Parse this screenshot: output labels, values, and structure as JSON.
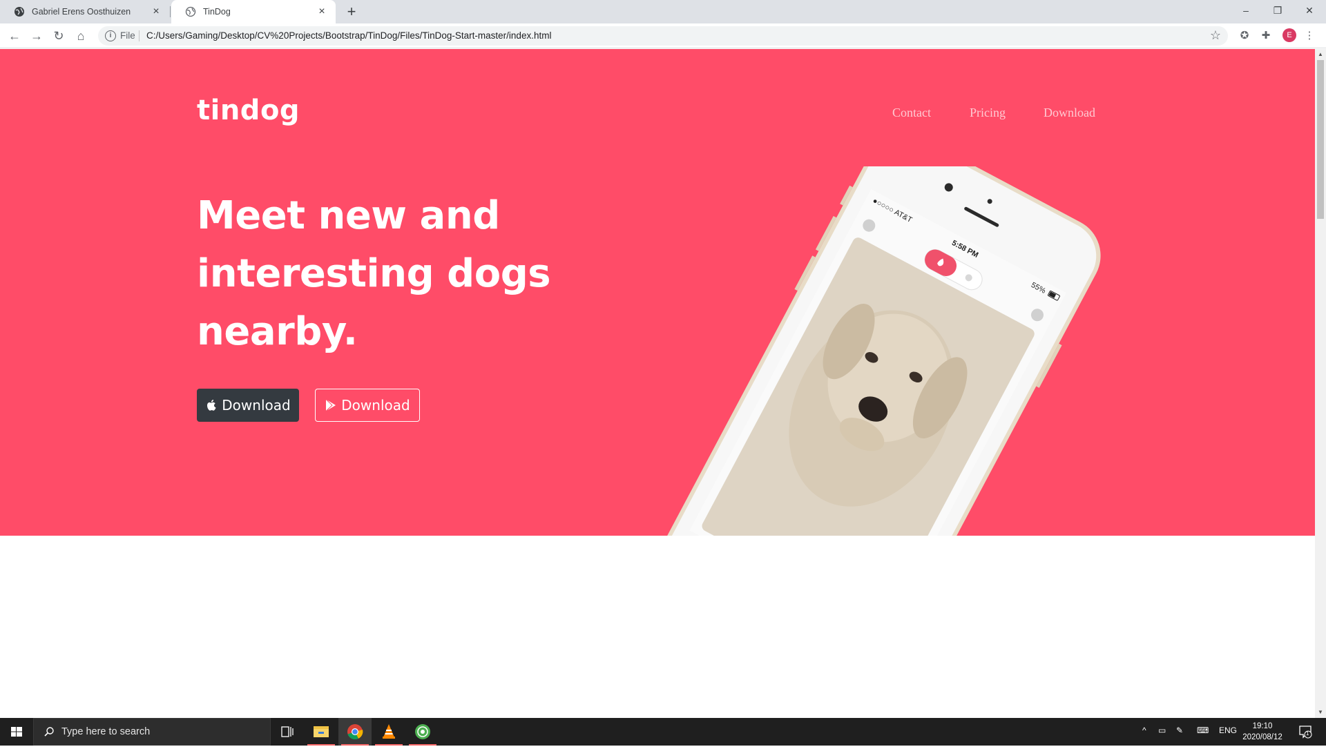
{
  "browser": {
    "tabs": [
      {
        "title": "Gabriel Erens Oosthuizen",
        "active": false
      },
      {
        "title": "TinDog",
        "active": true
      }
    ],
    "address": {
      "scheme_label": "File",
      "url": "C:/Users/Gaming/Desktop/CV%20Projects/Bootstrap/TinDog/Files/TinDog-Start-master/index.html"
    },
    "profile_initial": "E",
    "icons": [
      "back-icon",
      "forward-icon",
      "reload-icon",
      "home-icon",
      "info-icon",
      "star-icon",
      "extension-icon",
      "puzzle-icon",
      "menu-icon"
    ]
  },
  "page": {
    "brand": "tindog",
    "nav": [
      "Contact",
      "Pricing",
      "Download"
    ],
    "headline_lines": [
      "Meet new and",
      "interesting dogs",
      "nearby."
    ],
    "buttons": [
      {
        "label": "Download",
        "icon": "apple-icon",
        "style": "dark"
      },
      {
        "label": "Download",
        "icon": "play-store-icon",
        "style": "outline"
      }
    ],
    "phone_screen": {
      "carrier": "AT&T",
      "time": "5:58 PM",
      "battery": "55%"
    },
    "colors": {
      "hero": "#ff4c68",
      "dark_button": "#343a40"
    }
  },
  "taskbar": {
    "search_placeholder": "Type here to search",
    "language": "ENG",
    "time": "19:10",
    "date": "2020/08/12",
    "notification_count": "1",
    "apps": [
      "task-view-icon",
      "file-explorer-icon",
      "chrome-icon",
      "vlc-icon",
      "app-icon"
    ]
  }
}
